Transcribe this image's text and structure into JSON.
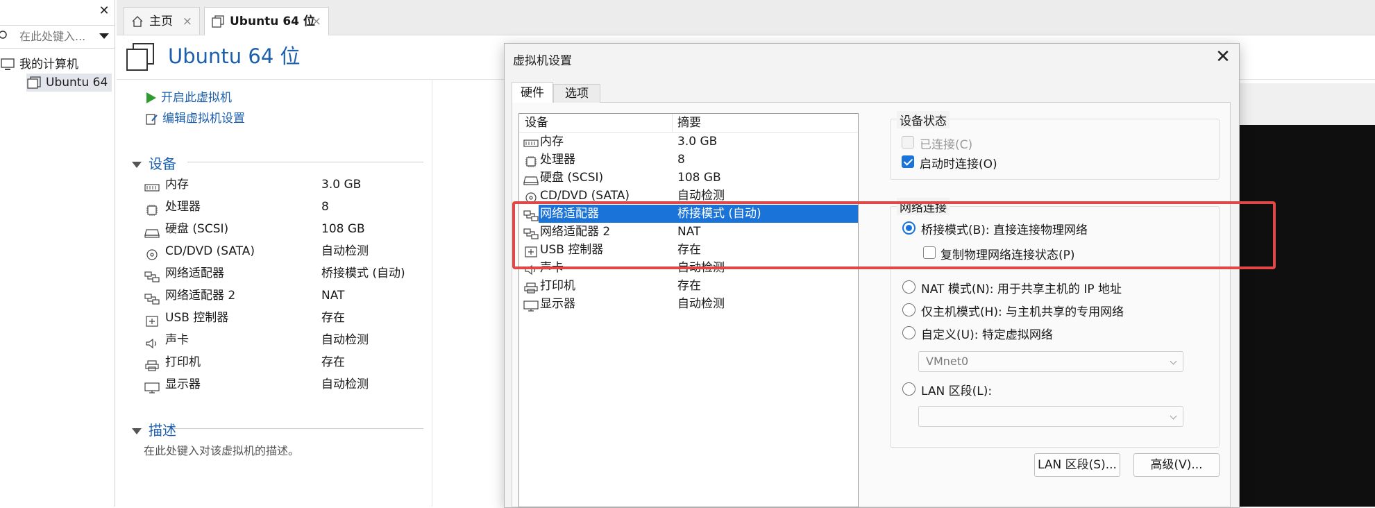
{
  "library": {
    "search_placeholder": "在此处键入...",
    "tree": {
      "root_label": "我的计算机",
      "child_label": "Ubuntu 64"
    }
  },
  "tabs": [
    {
      "label": "主页",
      "close": "×"
    },
    {
      "label": "Ubuntu 64 位",
      "close": "×"
    }
  ],
  "vm": {
    "title": "Ubuntu 64 位",
    "actions": {
      "start": "开启此虚拟机",
      "edit": "编辑虚拟机设置"
    },
    "devices_heading": "设备",
    "devices": [
      {
        "icon": "memory-icon",
        "name": "内存",
        "value": "3.0 GB"
      },
      {
        "icon": "cpu-icon",
        "name": "处理器",
        "value": "8"
      },
      {
        "icon": "harddisk-icon",
        "name": "硬盘 (SCSI)",
        "value": "108 GB"
      },
      {
        "icon": "cd-icon",
        "name": "CD/DVD (SATA)",
        "value": "自动检测"
      },
      {
        "icon": "network-icon",
        "name": "网络适配器",
        "value": "桥接模式 (自动)"
      },
      {
        "icon": "network-icon",
        "name": "网络适配器 2",
        "value": "NAT"
      },
      {
        "icon": "usb-icon",
        "name": "USB 控制器",
        "value": "存在"
      },
      {
        "icon": "sound-icon",
        "name": "声卡",
        "value": "自动检测"
      },
      {
        "icon": "printer-icon",
        "name": "打印机",
        "value": "存在"
      },
      {
        "icon": "display-icon",
        "name": "显示器",
        "value": "自动检测"
      }
    ],
    "desc_heading": "描述",
    "desc_placeholder": "在此处键入对该虚拟机的描述。"
  },
  "dialog": {
    "title": "虚拟机设置",
    "close": "✕",
    "tabs": {
      "hardware": "硬件",
      "options": "选项"
    },
    "table": {
      "col_device": "设备",
      "col_summary": "摘要",
      "rows": [
        {
          "icon": "memory-icon",
          "name": "内存",
          "value": "3.0 GB"
        },
        {
          "icon": "cpu-icon",
          "name": "处理器",
          "value": "8"
        },
        {
          "icon": "harddisk-icon",
          "name": "硬盘 (SCSI)",
          "value": "108 GB"
        },
        {
          "icon": "cd-icon",
          "name": "CD/DVD (SATA)",
          "value": "自动检测"
        },
        {
          "icon": "network-icon",
          "name": "网络适配器",
          "value": "桥接模式 (自动)",
          "selected": true
        },
        {
          "icon": "network-icon",
          "name": "网络适配器 2",
          "value": "NAT"
        },
        {
          "icon": "usb-icon",
          "name": "USB 控制器",
          "value": "存在"
        },
        {
          "icon": "sound-icon",
          "name": "声卡",
          "value": "自动检测"
        },
        {
          "icon": "printer-icon",
          "name": "打印机",
          "value": "存在"
        },
        {
          "icon": "display-icon",
          "name": "显示器",
          "value": "自动检测"
        }
      ]
    },
    "device_status": {
      "label": "设备状态",
      "connected": {
        "label": "已连接(C)",
        "checked": false,
        "disabled": true
      },
      "connect_at_power_on": {
        "label": "启动时连接(O)",
        "checked": true
      }
    },
    "network": {
      "label": "网络连接",
      "bridged": {
        "label": "桥接模式(B): 直接连接物理网络",
        "selected": true
      },
      "replicate": {
        "label": "复制物理网络连接状态(P)",
        "checked": false
      },
      "nat": {
        "label": "NAT 模式(N): 用于共享主机的 IP 地址",
        "selected": false
      },
      "hostonly": {
        "label": "仅主机模式(H): 与主机共享的专用网络",
        "selected": false
      },
      "custom": {
        "label": "自定义(U): 特定虚拟网络",
        "selected": false
      },
      "custom_value": "VMnet0",
      "lan": {
        "label": "LAN 区段(L):",
        "selected": false
      },
      "lan_value": ""
    },
    "buttons": {
      "lan_segments": "LAN 区段(S)...",
      "advanced": "高级(V)..."
    }
  },
  "colors": {
    "accent": "#1b5fae",
    "selection": "#1a73d9",
    "highlight": "#e04848"
  }
}
